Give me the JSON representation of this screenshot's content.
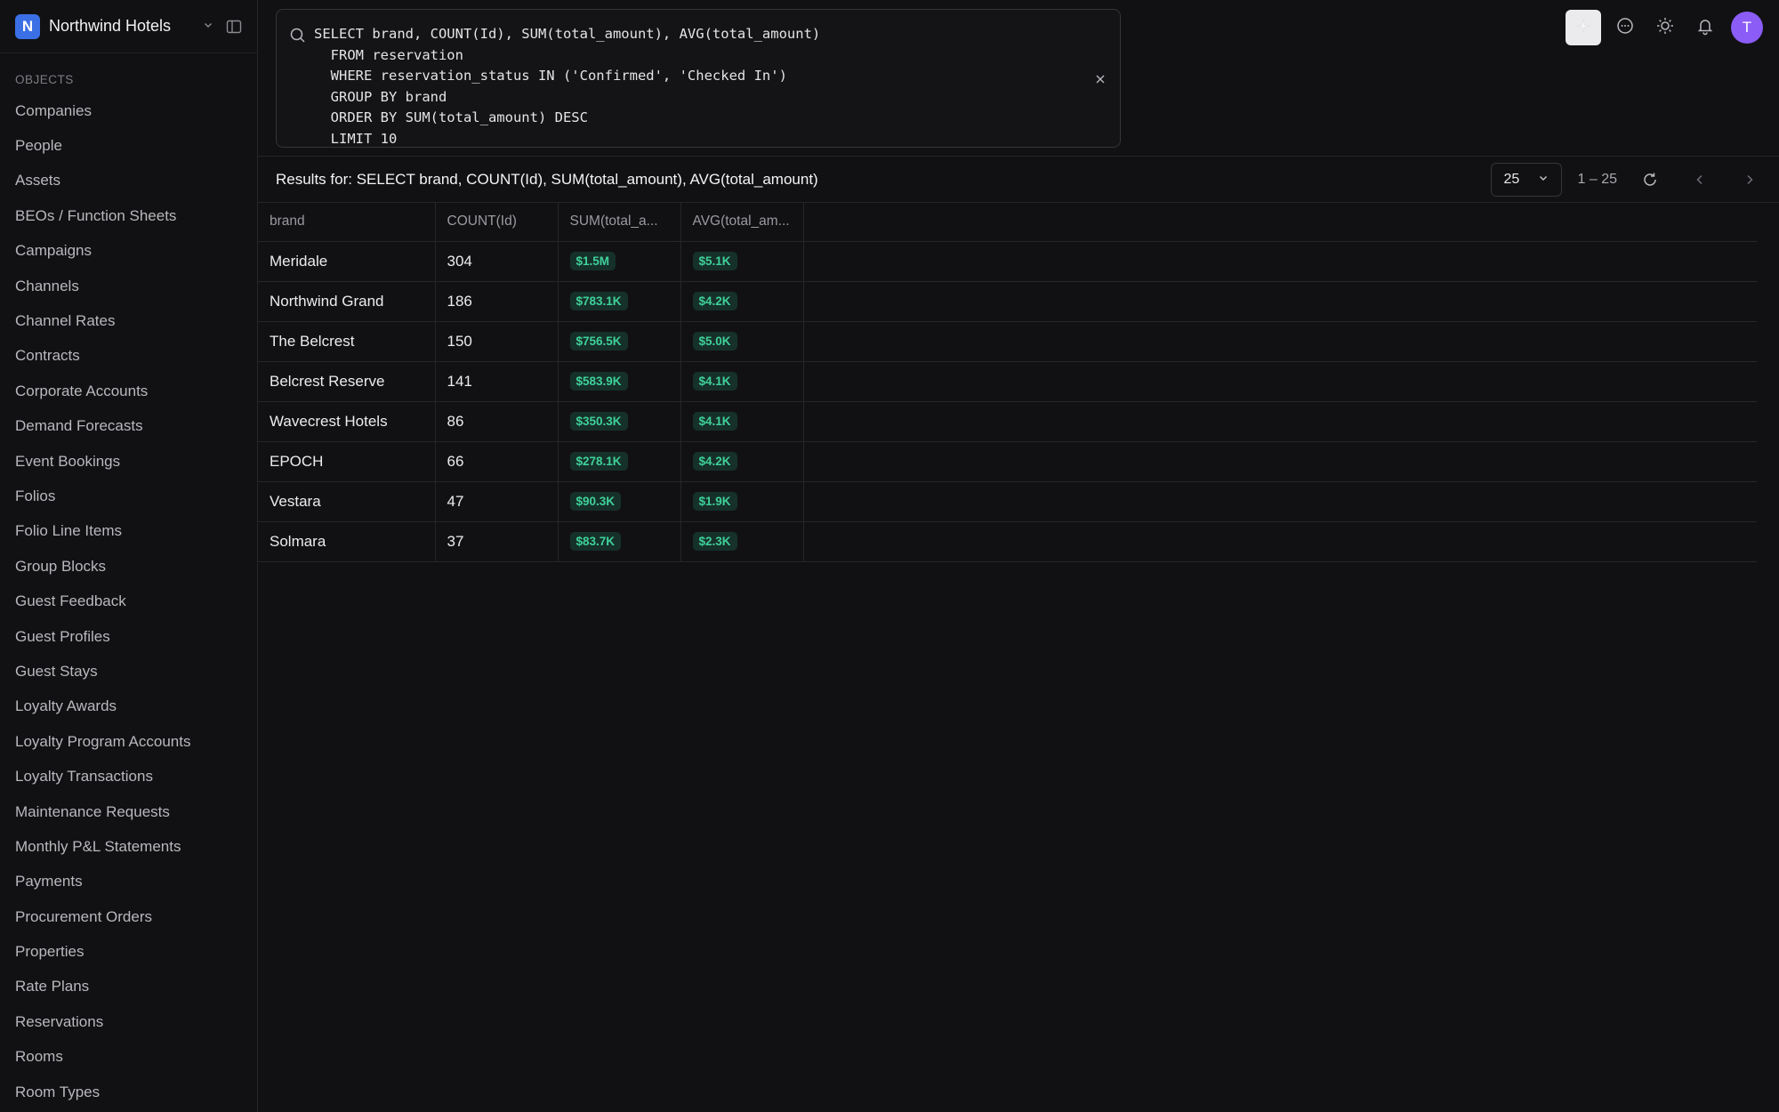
{
  "workspace": {
    "name": "Northwind Hotels",
    "logo_letter": "N"
  },
  "sidebar": {
    "section_label": "OBJECTS",
    "items": [
      "Companies",
      "People",
      "Assets",
      "BEOs / Function Sheets",
      "Campaigns",
      "Channels",
      "Channel Rates",
      "Contracts",
      "Corporate Accounts",
      "Demand Forecasts",
      "Event Bookings",
      "Folios",
      "Folio Line Items",
      "Group Blocks",
      "Guest Feedback",
      "Guest Profiles",
      "Guest Stays",
      "Loyalty Awards",
      "Loyalty Program Accounts",
      "Loyalty Transactions",
      "Maintenance Requests",
      "Monthly P&L Statements",
      "Payments",
      "Procurement Orders",
      "Properties",
      "Rate Plans",
      "Reservations",
      "Rooms",
      "Room Types"
    ]
  },
  "query": {
    "text": "SELECT brand, COUNT(Id), SUM(total_amount), AVG(total_amount)\n  FROM reservation\n  WHERE reservation_status IN ('Confirmed', 'Checked In')\n  GROUP BY brand\n  ORDER BY SUM(total_amount) DESC\n  LIMIT 10"
  },
  "user": {
    "avatar_letter": "T"
  },
  "results": {
    "title": "Results for: SELECT brand, COUNT(Id), SUM(total_amount), AVG(total_amount)",
    "page_size": "25",
    "range": "1 – 25",
    "columns": [
      "brand",
      "COUNT(Id)",
      "SUM(total_a...",
      "AVG(total_am..."
    ],
    "rows": [
      [
        "Meridale",
        "304",
        "$1.5M",
        "$5.1K"
      ],
      [
        "Northwind Grand",
        "186",
        "$783.1K",
        "$4.2K"
      ],
      [
        "The Belcrest",
        "150",
        "$756.5K",
        "$5.0K"
      ],
      [
        "Belcrest Reserve",
        "141",
        "$583.9K",
        "$4.1K"
      ],
      [
        "Wavecrest Hotels",
        "86",
        "$350.3K",
        "$4.1K"
      ],
      [
        "EPOCH",
        "66",
        "$278.1K",
        "$4.2K"
      ],
      [
        "Vestara",
        "47",
        "$90.3K",
        "$1.9K"
      ],
      [
        "Solmara",
        "37",
        "$83.7K",
        "$2.3K"
      ]
    ]
  },
  "colors": {
    "accent": "#3b6fe6",
    "avatar": "#8b5cf6",
    "money_text": "#3fd19a",
    "money_bg": "#16302a"
  }
}
